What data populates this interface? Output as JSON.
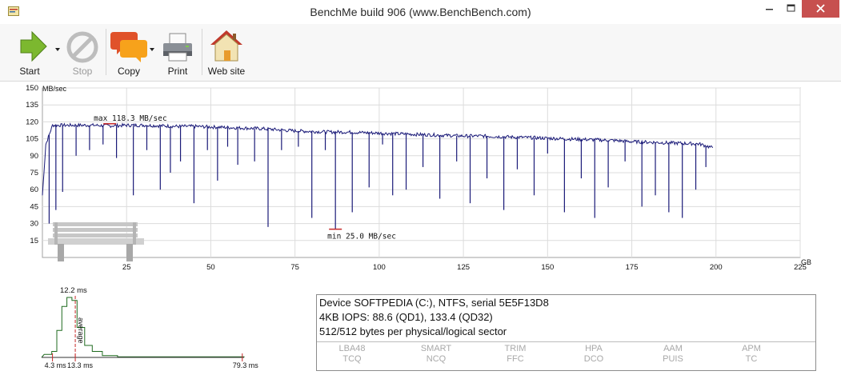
{
  "window": {
    "title": "BenchMe build 906 (www.BenchBench.com)"
  },
  "toolbar": {
    "start_label": "Start",
    "stop_label": "Stop",
    "copy_label": "Copy",
    "print_label": "Print",
    "website_label": "Web site"
  },
  "chart_data": [
    {
      "type": "line",
      "title": "",
      "ylabel": "MB/sec",
      "xlabel": "GB",
      "xlim": [
        0,
        225
      ],
      "ylim": [
        0,
        150
      ],
      "x_ticks": [
        "25",
        "50",
        "75",
        "100",
        "125",
        "150",
        "175",
        "200",
        "225"
      ],
      "y_ticks": [
        "15",
        "30",
        "45",
        "60",
        "75",
        "90",
        "105",
        "120",
        "135",
        "150"
      ],
      "grid": true,
      "series": [
        {
          "x": [
            0,
            1,
            3,
            5,
            10,
            15,
            20,
            25,
            30,
            35,
            40,
            45,
            50,
            55,
            60,
            65,
            70,
            75,
            80,
            85,
            90,
            95,
            100,
            105,
            110,
            115,
            120,
            125,
            130,
            135,
            140,
            145,
            150,
            155,
            160,
            165,
            170,
            175,
            180,
            185,
            190,
            195,
            199
          ],
          "y": [
            55,
            100,
            117,
            117,
            117,
            117,
            116.5,
            117,
            117,
            116.5,
            116,
            116,
            115.5,
            115,
            114.5,
            114,
            113,
            112,
            111.5,
            111,
            111,
            110.5,
            110,
            109.5,
            109,
            108.5,
            108,
            107.5,
            107.5,
            107,
            106.5,
            106,
            105.5,
            105,
            104.5,
            104,
            103.5,
            102.5,
            102,
            101.5,
            101,
            100.5,
            97
          ]
        }
      ],
      "dips": [
        {
          "x": 2,
          "y": 30
        },
        {
          "x": 4,
          "y": 42
        },
        {
          "x": 6,
          "y": 58
        },
        {
          "x": 10,
          "y": 90
        },
        {
          "x": 14,
          "y": 95
        },
        {
          "x": 18,
          "y": 100
        },
        {
          "x": 22,
          "y": 88
        },
        {
          "x": 27,
          "y": 55
        },
        {
          "x": 31,
          "y": 95
        },
        {
          "x": 35,
          "y": 60
        },
        {
          "x": 38,
          "y": 75
        },
        {
          "x": 41,
          "y": 85
        },
        {
          "x": 45,
          "y": 48
        },
        {
          "x": 49,
          "y": 95
        },
        {
          "x": 52,
          "y": 68
        },
        {
          "x": 55,
          "y": 98
        },
        {
          "x": 58,
          "y": 82
        },
        {
          "x": 63,
          "y": 85
        },
        {
          "x": 67,
          "y": 27
        },
        {
          "x": 71,
          "y": 95
        },
        {
          "x": 76,
          "y": 98
        },
        {
          "x": 80,
          "y": 35
        },
        {
          "x": 84,
          "y": 95
        },
        {
          "x": 87,
          "y": 25
        },
        {
          "x": 92,
          "y": 40
        },
        {
          "x": 97,
          "y": 62
        },
        {
          "x": 101,
          "y": 100
        },
        {
          "x": 104,
          "y": 55
        },
        {
          "x": 108,
          "y": 60
        },
        {
          "x": 113,
          "y": 80
        },
        {
          "x": 118,
          "y": 52
        },
        {
          "x": 123,
          "y": 85
        },
        {
          "x": 127,
          "y": 48
        },
        {
          "x": 132,
          "y": 70
        },
        {
          "x": 137,
          "y": 42
        },
        {
          "x": 141,
          "y": 78
        },
        {
          "x": 146,
          "y": 55
        },
        {
          "x": 150,
          "y": 92
        },
        {
          "x": 155,
          "y": 40
        },
        {
          "x": 160,
          "y": 70
        },
        {
          "x": 164,
          "y": 35
        },
        {
          "x": 168,
          "y": 62
        },
        {
          "x": 173,
          "y": 85
        },
        {
          "x": 178,
          "y": 45
        },
        {
          "x": 182,
          "y": 55
        },
        {
          "x": 186,
          "y": 40
        },
        {
          "x": 190,
          "y": 35
        },
        {
          "x": 194,
          "y": 60
        },
        {
          "x": 197,
          "y": 80
        }
      ],
      "annotations": {
        "max_label": "max 118.3 MB/sec",
        "max": {
          "x": 20,
          "y": 118.3
        },
        "min_label": "min 25.0 MB/sec",
        "min": {
          "x": 87,
          "y": 25.0
        }
      }
    },
    {
      "type": "histogram",
      "title": "",
      "x_labels": [
        "4.3 ms",
        "13.3 ms",
        "79.3 ms"
      ],
      "peak_label": "12.2 ms",
      "average_label": "average",
      "bins": [
        {
          "ms": 1,
          "h": 0.05
        },
        {
          "ms": 4,
          "h": 0.1
        },
        {
          "ms": 6,
          "h": 0.45
        },
        {
          "ms": 8,
          "h": 0.85
        },
        {
          "ms": 10,
          "h": 1.0
        },
        {
          "ms": 12,
          "h": 0.95
        },
        {
          "ms": 14,
          "h": 0.5
        },
        {
          "ms": 17,
          "h": 0.2
        },
        {
          "ms": 20,
          "h": 0.1
        },
        {
          "ms": 24,
          "h": 0.03
        },
        {
          "ms": 30,
          "h": 0.01
        },
        {
          "ms": 50,
          "h": 0.01
        },
        {
          "ms": 79,
          "h": 0.01
        }
      ],
      "average_ms": 13.3,
      "marks_ms": [
        4.3,
        13.3,
        79.3
      ]
    }
  ],
  "info": {
    "device_line": "Device SOFTPEDIA (C:), NTFS,  serial 5E5F13D8",
    "iops_line": "4KB IOPS: 88.6 (QD1), 133.4 (QD32)",
    "sector_line": "512/512 bytes per physical/logical sector",
    "features": [
      {
        "top": "LBA48",
        "bottom": "TCQ"
      },
      {
        "top": "SMART",
        "bottom": "NCQ"
      },
      {
        "top": "TRIM",
        "bottom": "FFC"
      },
      {
        "top": "HPA",
        "bottom": "DCO"
      },
      {
        "top": "AAM",
        "bottom": "PUIS"
      },
      {
        "top": "APM",
        "bottom": "TC"
      }
    ]
  },
  "colors": {
    "series": "#1a1a78",
    "histogram": "#1f6b1f",
    "close_button": "#c7504f",
    "marker": "#c62828"
  }
}
